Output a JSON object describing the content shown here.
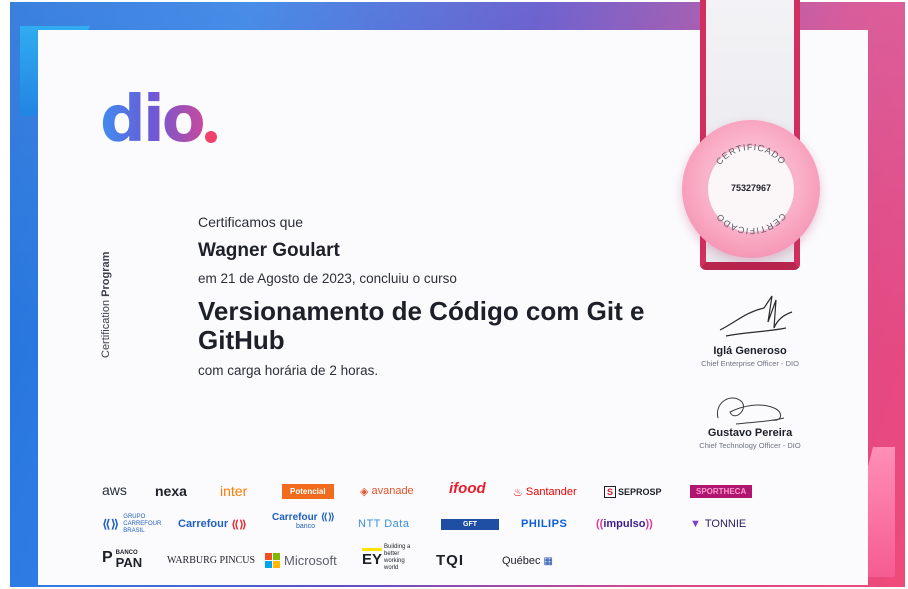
{
  "logo": {
    "text": "dio"
  },
  "side_label": {
    "first": "Certification",
    "second": "Program"
  },
  "certificate": {
    "intro": "Certificamos que",
    "name": "Wagner Goulart",
    "date_line": "em 21 de Agosto de 2023, concluiu o curso",
    "course_title": "Versionamento de Código com Git e GitHub",
    "hours_line": "com carga horária de 2 horas."
  },
  "seal": {
    "top_text": "CERTIFICADO",
    "bottom_text": "CERTIFICADO",
    "number": "75327967"
  },
  "signatures": [
    {
      "name": "Iglá Generoso",
      "title": "Chief Enterprise Officer - DIO"
    },
    {
      "name": "Gustavo Pereira",
      "title": "Chief Technology Officer - DIO"
    }
  ],
  "partners": {
    "aws": "aws",
    "nexa": "nexa",
    "inter": "inter",
    "potencial": "Potencial",
    "avanade": "avanade",
    "ifood": "ifood",
    "santander": "Santander",
    "seprosp": "SEPROSP",
    "sportheca": "SPORTHECA",
    "grupo_carrefour": "GRUPO CARREFOUR BRASIL",
    "carrefour": "Carrefour",
    "carrefour_banco": "Carrefour",
    "carrefour_banco_sub": "banco",
    "nttdata": "NTT Data",
    "gft": "GFT",
    "philips": "PHILIPS",
    "impulso": "impulso",
    "tonnie": "TONNIE",
    "banco_pan_top": "BANCO",
    "banco_pan": "PAN",
    "warburg": "WARBURG PINCUS",
    "microsoft": "Microsoft",
    "ey": "EY",
    "ey_tag": "Building a better working world",
    "tqi": "TQI",
    "quebec": "Québec"
  },
  "colors": {
    "brand_blue": "#1f6fd8",
    "brand_pink": "#f04a7a",
    "dot": "#f0436b",
    "ribbon": "#d1305f"
  }
}
